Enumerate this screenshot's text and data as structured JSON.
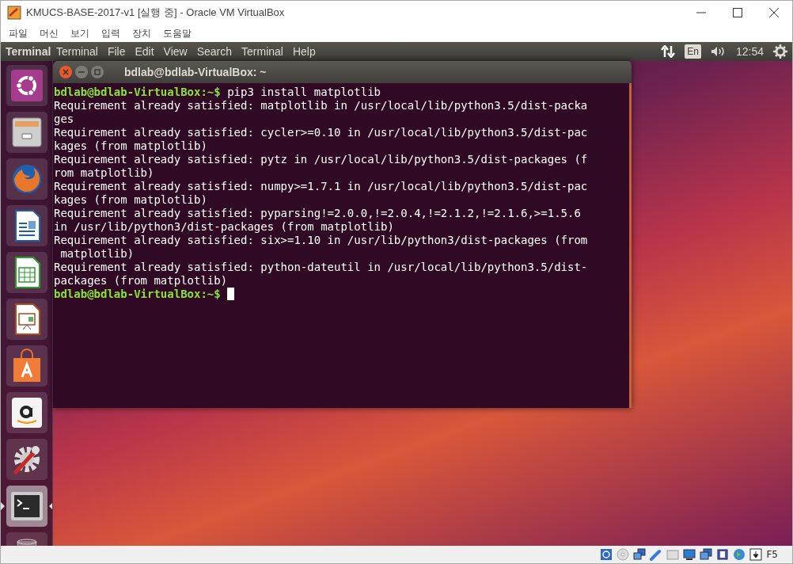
{
  "window": {
    "title": "KMUCS-BASE-2017-v1 [실행 중] - Oracle VM VirtualBox"
  },
  "menu": [
    "파일",
    "머신",
    "보기",
    "입력",
    "장치",
    "도움말"
  ],
  "top_panel": {
    "app_name": "Terminal",
    "menus": [
      "Terminal",
      "File",
      "Edit",
      "View",
      "Search",
      "Terminal",
      "Help"
    ],
    "keyboard": "En",
    "time": "12:54"
  },
  "launcher": [
    {
      "kind": "ubuntu",
      "active": false
    },
    {
      "kind": "files",
      "active": false
    },
    {
      "kind": "firefox",
      "active": false
    },
    {
      "kind": "writer",
      "active": false
    },
    {
      "kind": "calc",
      "active": false
    },
    {
      "kind": "impress",
      "active": false
    },
    {
      "kind": "software",
      "active": false
    },
    {
      "kind": "amazon",
      "active": false
    },
    {
      "kind": "settings",
      "active": false
    },
    {
      "kind": "terminal",
      "active": true
    },
    {
      "kind": "trash",
      "active": false
    }
  ],
  "terminal": {
    "title": "bdlab@bdlab-VirtualBox: ~",
    "lines": [
      {
        "kind": "prompt",
        "prompt": "bdlab@bdlab-VirtualBox:~$",
        "command": "pip3 install matplotlib"
      },
      {
        "kind": "output",
        "text": "Requirement already satisfied: matplotlib in /usr/local/lib/python3.5/dist-packa"
      },
      {
        "kind": "output",
        "text": "ges"
      },
      {
        "kind": "output",
        "text": "Requirement already satisfied: cycler>=0.10 in /usr/local/lib/python3.5/dist-pac"
      },
      {
        "kind": "output",
        "text": "kages (from matplotlib)"
      },
      {
        "kind": "output",
        "text": "Requirement already satisfied: pytz in /usr/local/lib/python3.5/dist-packages (f"
      },
      {
        "kind": "output",
        "text": "rom matplotlib)"
      },
      {
        "kind": "output",
        "text": "Requirement already satisfied: numpy>=1.7.1 in /usr/local/lib/python3.5/dist-pac"
      },
      {
        "kind": "output",
        "text": "kages (from matplotlib)"
      },
      {
        "kind": "output",
        "text": "Requirement already satisfied: pyparsing!=2.0.0,!=2.0.4,!=2.1.2,!=2.1.6,>=1.5.6"
      },
      {
        "kind": "output",
        "text": "in /usr/lib/python3/dist-packages (from matplotlib)"
      },
      {
        "kind": "output",
        "text": "Requirement already satisfied: six>=1.10 in /usr/lib/python3/dist-packages (from"
      },
      {
        "kind": "output",
        "text": " matplotlib)"
      },
      {
        "kind": "output",
        "text": "Requirement already satisfied: python-dateutil in /usr/local/lib/python3.5/dist-"
      },
      {
        "kind": "output",
        "text": "packages (from matplotlib)"
      },
      {
        "kind": "prompt",
        "prompt": "bdlab@bdlab-VirtualBox:~$",
        "cursor": true
      }
    ]
  },
  "status_bar": {
    "host_key": "F5"
  }
}
